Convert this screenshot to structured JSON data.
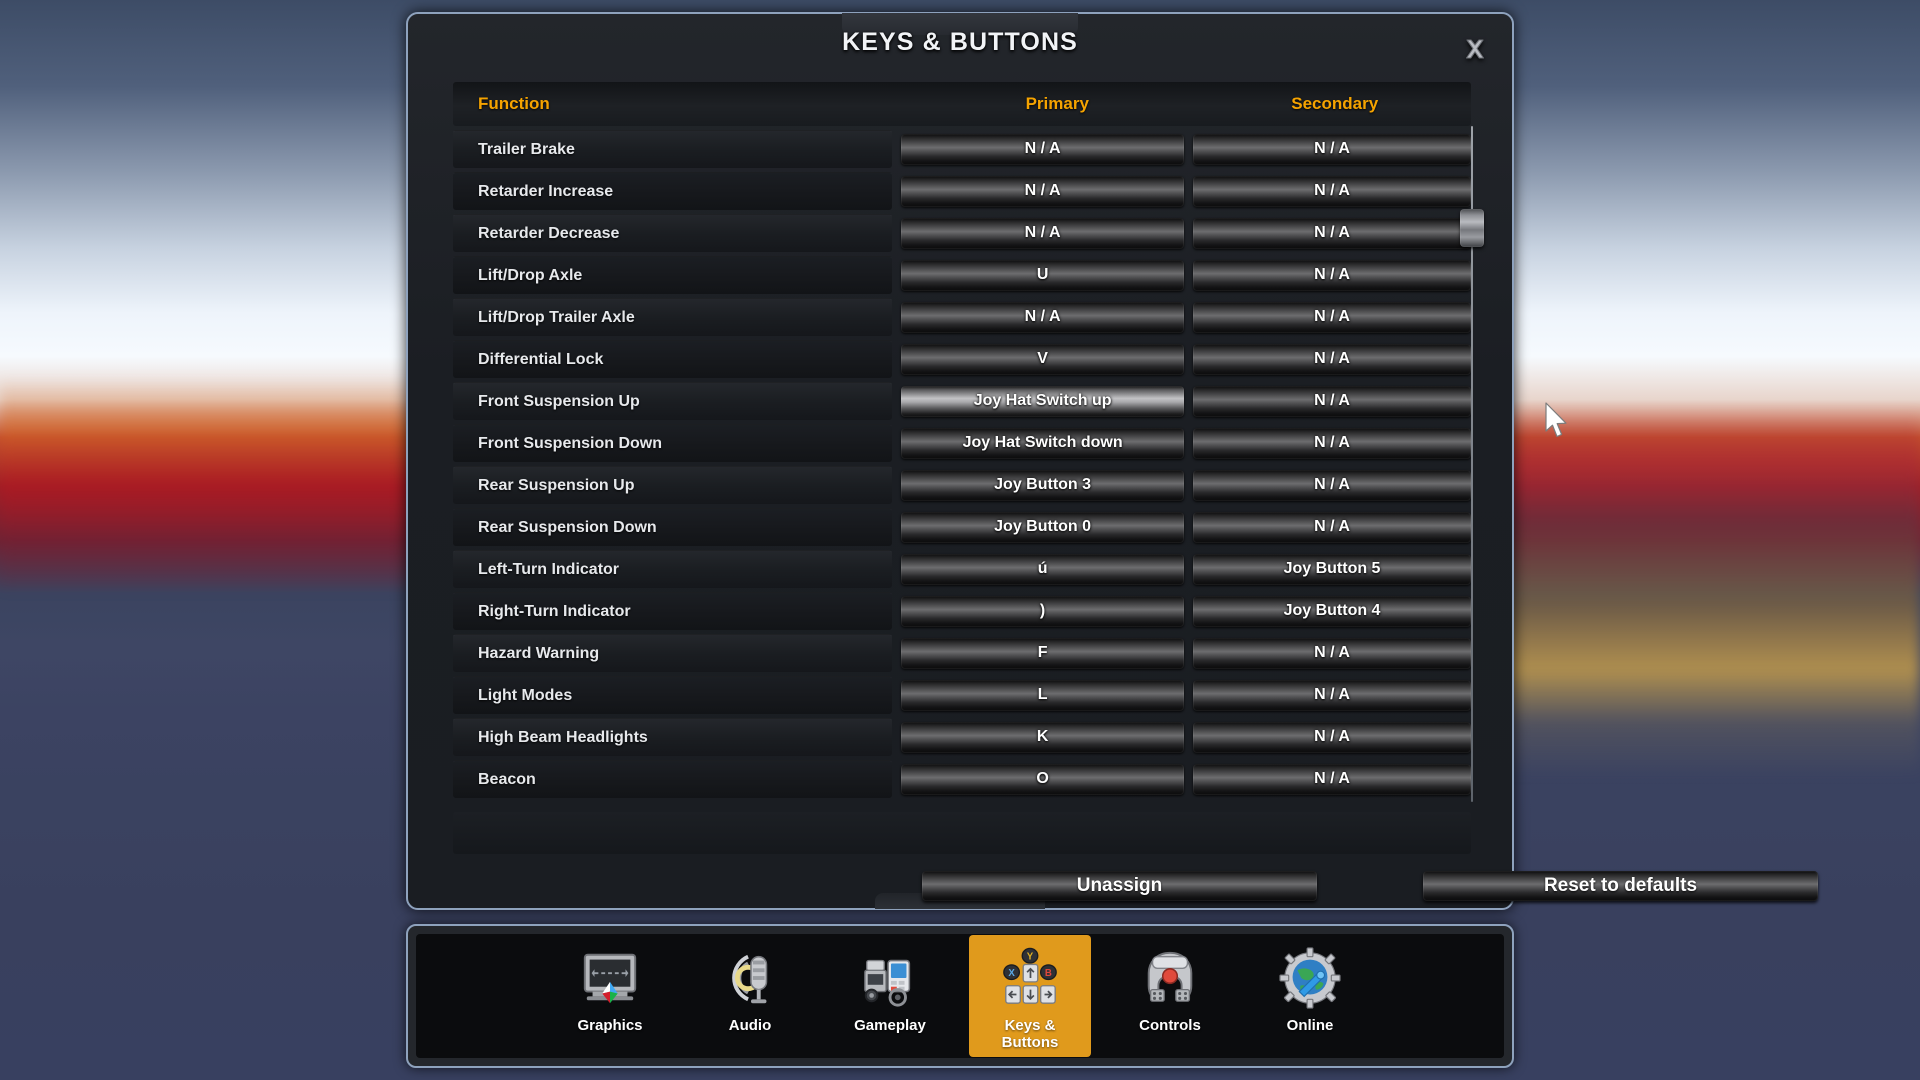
{
  "dialog": {
    "title": "KEYS & BUTTONS",
    "close_icon": "close-icon"
  },
  "table": {
    "headers": {
      "function": "Function",
      "primary": "Primary",
      "secondary": "Secondary"
    },
    "header_color": "#f5a300",
    "rows": [
      {
        "function": "Trailer Brake",
        "primary": "N / A",
        "secondary": "N / A"
      },
      {
        "function": "Retarder Increase",
        "primary": "N / A",
        "secondary": "N / A"
      },
      {
        "function": "Retarder Decrease",
        "primary": "N / A",
        "secondary": "N / A"
      },
      {
        "function": "Lift/Drop Axle",
        "primary": "U",
        "secondary": "N / A"
      },
      {
        "function": "Lift/Drop Trailer Axle",
        "primary": "N / A",
        "secondary": "N / A"
      },
      {
        "function": "Differential Lock",
        "primary": "V",
        "secondary": "N / A"
      },
      {
        "function": "Front Suspension Up",
        "primary": "Joy Hat Switch up",
        "secondary": "N / A",
        "primary_hover": true
      },
      {
        "function": "Front Suspension Down",
        "primary": "Joy Hat Switch down",
        "secondary": "N / A"
      },
      {
        "function": "Rear Suspension Up",
        "primary": "Joy Button 3",
        "secondary": "N / A"
      },
      {
        "function": "Rear Suspension Down",
        "primary": "Joy Button 0",
        "secondary": "N / A"
      },
      {
        "function": "Left-Turn Indicator",
        "primary": "ú",
        "secondary": "Joy Button 5"
      },
      {
        "function": "Right-Turn Indicator",
        "primary": ")",
        "secondary": "Joy Button 4"
      },
      {
        "function": "Hazard Warning",
        "primary": "F",
        "secondary": "N / A"
      },
      {
        "function": "Light Modes",
        "primary": "L",
        "secondary": "N / A"
      },
      {
        "function": "High Beam Headlights",
        "primary": "K",
        "secondary": "N / A"
      },
      {
        "function": "Beacon",
        "primary": "O",
        "secondary": "N / A"
      }
    ]
  },
  "actions": {
    "unassign": "Unassign",
    "reset": "Reset to defaults"
  },
  "nav": {
    "active_color": "#e09a1c",
    "items": [
      {
        "label": "Graphics",
        "icon": "monitor-icon",
        "active": false
      },
      {
        "label": "Audio",
        "icon": "microphone-icon",
        "active": false
      },
      {
        "label": "Gameplay",
        "icon": "truck-icon",
        "active": false
      },
      {
        "label": "Keys &\nButtons",
        "icon": "keypad-icon",
        "active": true
      },
      {
        "label": "Controls",
        "icon": "steering-wheel-icon",
        "active": false
      },
      {
        "label": "Online",
        "icon": "globe-gear-icon",
        "active": false
      }
    ]
  },
  "scrollbar": {
    "thumb_position_percent": 13
  }
}
